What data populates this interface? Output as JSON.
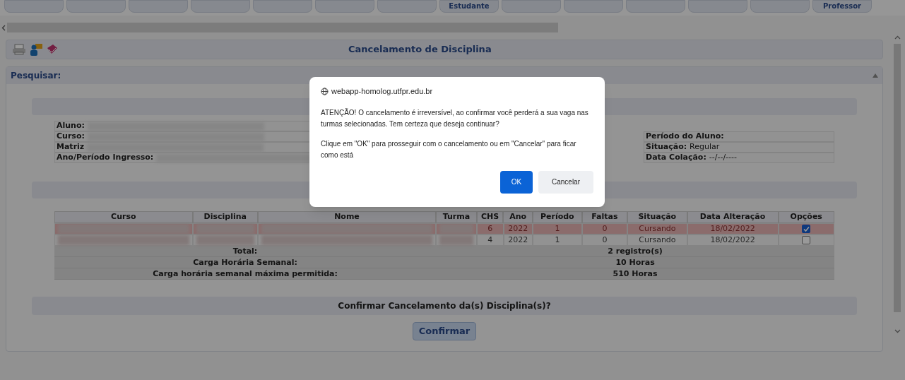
{
  "top_tabs": [
    {
      "kind": "blank"
    },
    {
      "kind": "blank"
    },
    {
      "kind": "blank"
    },
    {
      "kind": "blank"
    },
    {
      "kind": "blank"
    },
    {
      "kind": "blank"
    },
    {
      "kind": "blank"
    },
    {
      "kind": "text",
      "label": "Estudante"
    },
    {
      "kind": "blank"
    },
    {
      "kind": "blank"
    },
    {
      "kind": "blank"
    },
    {
      "kind": "blank"
    },
    {
      "kind": "blank"
    },
    {
      "kind": "text",
      "label": "Professor"
    }
  ],
  "page_title": "Cancelamento de Disciplina",
  "section_title": "Pesquisar:",
  "student_info": {
    "left": [
      {
        "label": "Aluno:"
      },
      {
        "label": "Curso:"
      },
      {
        "label": "Matriz"
      },
      {
        "label": "Ano/Período Ingresso:"
      }
    ],
    "right": [
      {
        "label": "Período do Aluno:"
      },
      {
        "label": "Situação:",
        "value": "Regular"
      },
      {
        "label": "Data Colação:",
        "value": "--/--/----"
      }
    ]
  },
  "table": {
    "columns": [
      "Curso",
      "Disciplina",
      "Nome",
      "Turma",
      "CHS",
      "Ano",
      "Período",
      "Faltas",
      "Situação",
      "Data Alteração",
      "Opções"
    ],
    "rows": [
      {
        "chs": "6",
        "ano": "2022",
        "periodo": "1",
        "faltas": "0",
        "situacao": "Cursando",
        "data": "18/02/2022",
        "checked": true
      },
      {
        "chs": "4",
        "ano": "2022",
        "periodo": "1",
        "faltas": "0",
        "situacao": "Cursando",
        "data": "18/02/2022",
        "checked": false
      }
    ],
    "summary": [
      {
        "label": "Total:",
        "value": "2 registro(s)"
      },
      {
        "label": "Carga Horária Semanal:",
        "value": "10 Horas"
      },
      {
        "label": "Carga horária semanal máxima permitida:",
        "value": "510 Horas"
      }
    ]
  },
  "confirm_prompt": "Confirmar Cancelamento da(s) Disciplina(s)?",
  "confirm_button": "Confirmar",
  "dialog": {
    "origin": "webapp-homolog.utfpr.edu.br",
    "message": "ATENÇÃO! O cancelamento é irreversível, ao confirmar você perderá a sua vaga nas turmas selecionadas. Tem certeza que deseja continuar?",
    "hint": "Clique em \"OK\" para prosseguir com o cancelamento ou em \"Cancelar\" para ficar como está",
    "ok": "OK",
    "cancel": "Cancelar"
  }
}
